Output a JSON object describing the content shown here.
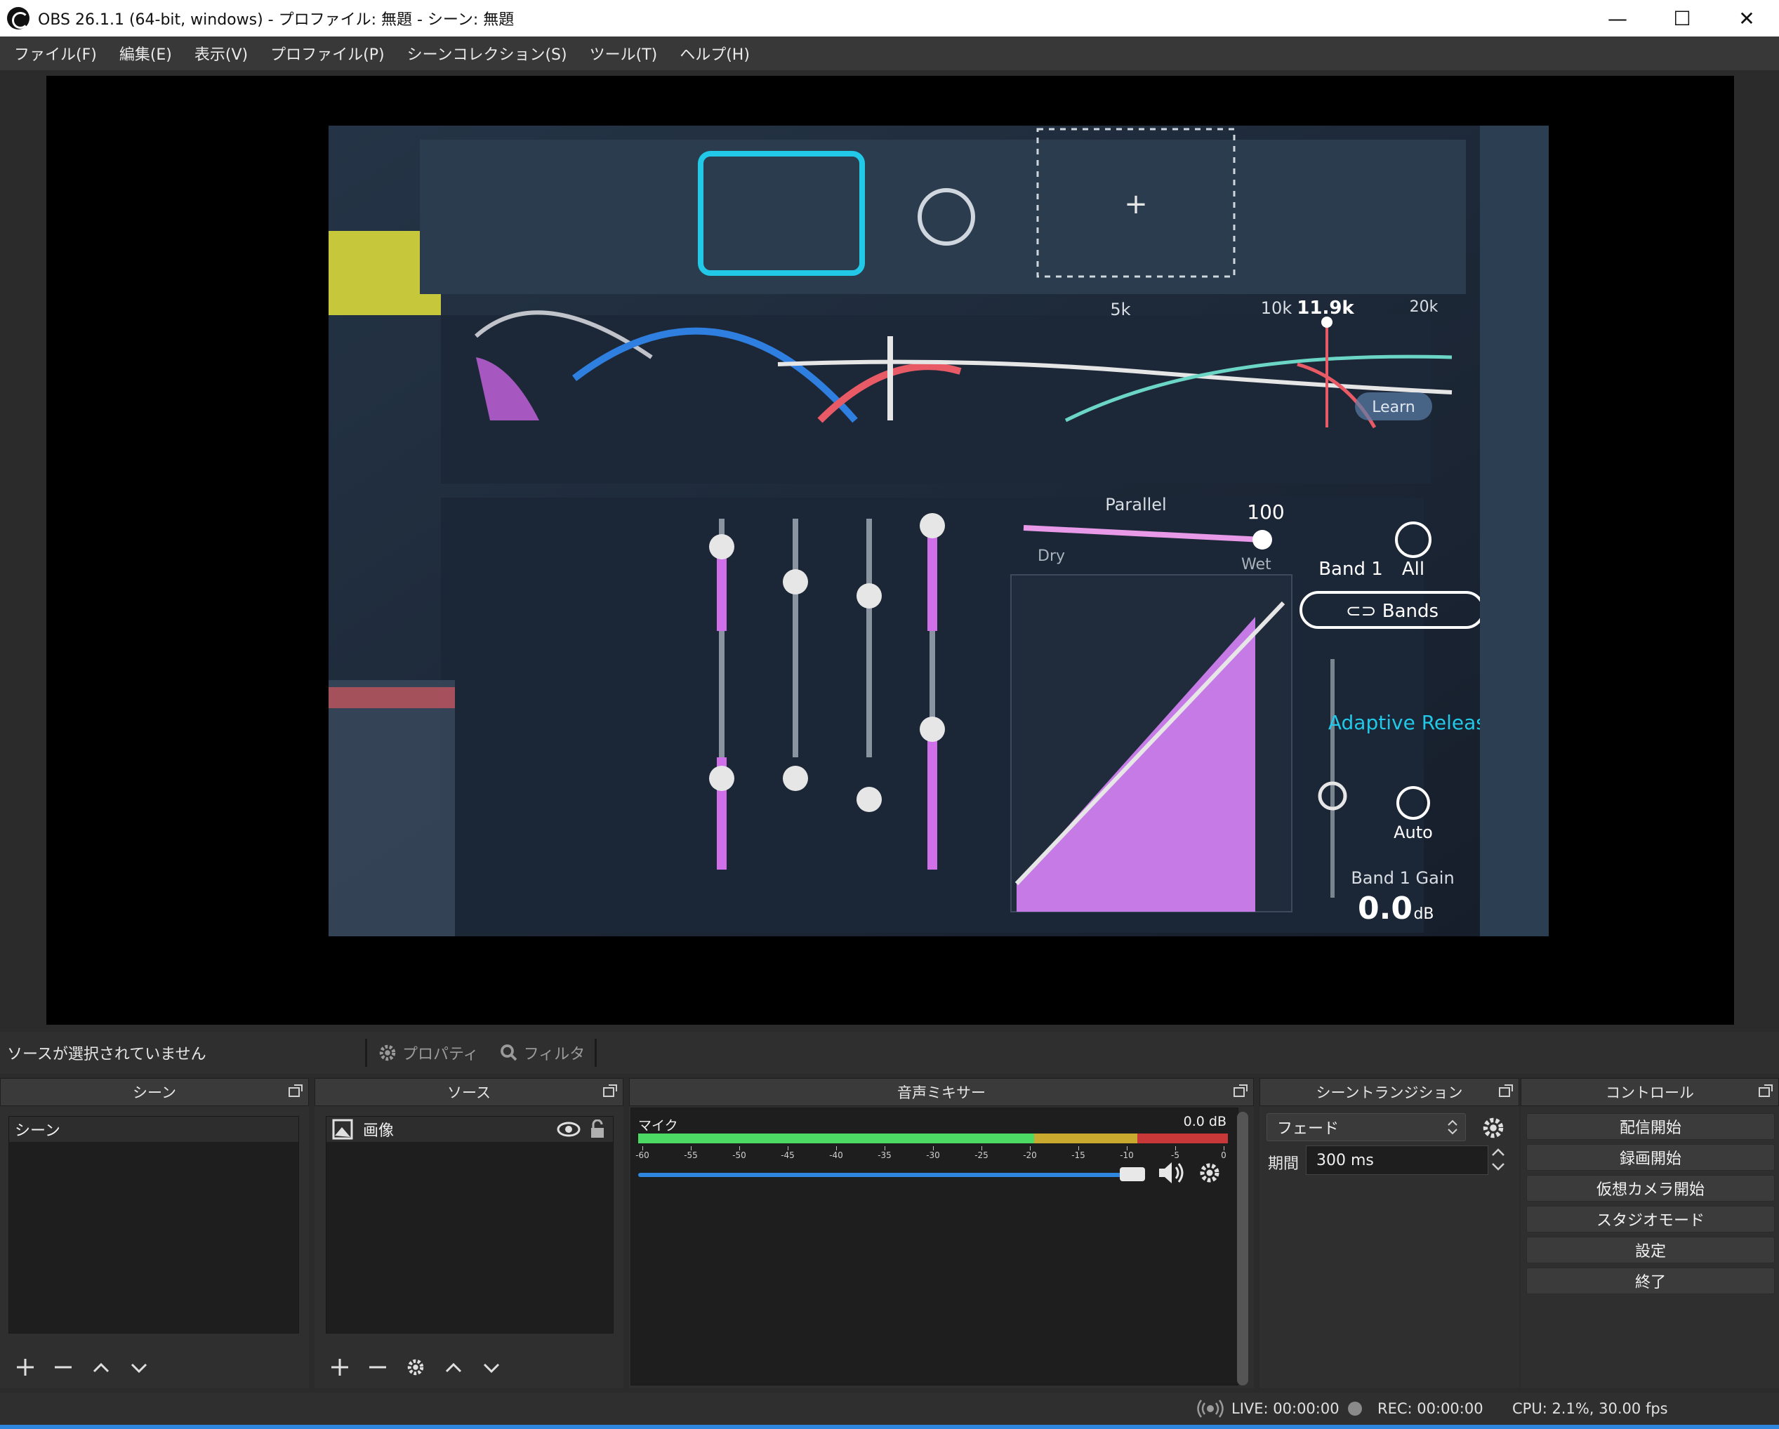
{
  "window": {
    "title": "OBS 26.1.1 (64-bit, windows) - プロファイル: 無題 - シーン: 無題",
    "minimize": "—",
    "maximize": "☐",
    "close": "✕"
  },
  "menu": [
    "ファイル(F)",
    "編集(E)",
    "表示(V)",
    "プロファイル(P)",
    "シーンコレクション(S)",
    "ツール(T)",
    "ヘルプ(H)"
  ],
  "source_toolbar": {
    "no_source": "ソースが選択されていません",
    "properties": "プロパティ",
    "filters": "フィルタ"
  },
  "preview_image": {
    "labels": {
      "freq_5k": "5k",
      "freq_10k": "10k",
      "freq_11_9k": "11.9k",
      "freq_20k": "20k",
      "parallel": "Parallel",
      "parallel_value": "100",
      "dry": "Dry",
      "wet": "Wet",
      "band1": "Band 1",
      "all": "All",
      "bands": "⊂⊃ Bands",
      "adaptive_release": "Adaptive Release",
      "auto": "Auto",
      "band1_gain": "Band 1 Gain",
      "gain_value": "0.0",
      "gain_unit": "dB",
      "learn": "Learn",
      "plus": "+"
    }
  },
  "scenes": {
    "header": "シーン",
    "items": [
      "シーン"
    ]
  },
  "sources": {
    "header": "ソース",
    "items": [
      {
        "name": "画像"
      }
    ]
  },
  "mixer": {
    "header": "音声ミキサー",
    "channel": {
      "name": "マイク",
      "db": "0.0 dB",
      "ticks": [
        "-60",
        "-55",
        "-50",
        "-45",
        "-40",
        "-35",
        "-30",
        "-25",
        "-20",
        "-15",
        "-10",
        "-5",
        "0"
      ],
      "volume": 0.97
    }
  },
  "transitions": {
    "header": "シーントランジション",
    "selected": "フェード",
    "duration_label": "期間",
    "duration_value": "300 ms"
  },
  "controls": {
    "header": "コントロール",
    "buttons": [
      "配信開始",
      "録画開始",
      "仮想カメラ開始",
      "スタジオモード",
      "設定",
      "終了"
    ]
  },
  "status": {
    "live": "LIVE: 00:00:00",
    "rec": "REC: 00:00:00",
    "cpu": "CPU: 2.1%, 30.00 fps"
  },
  "colors": {
    "accent": "#2e86de",
    "meter_green": "#4cd964",
    "meter_yellow": "#c9a92e",
    "meter_red": "#c83838"
  }
}
